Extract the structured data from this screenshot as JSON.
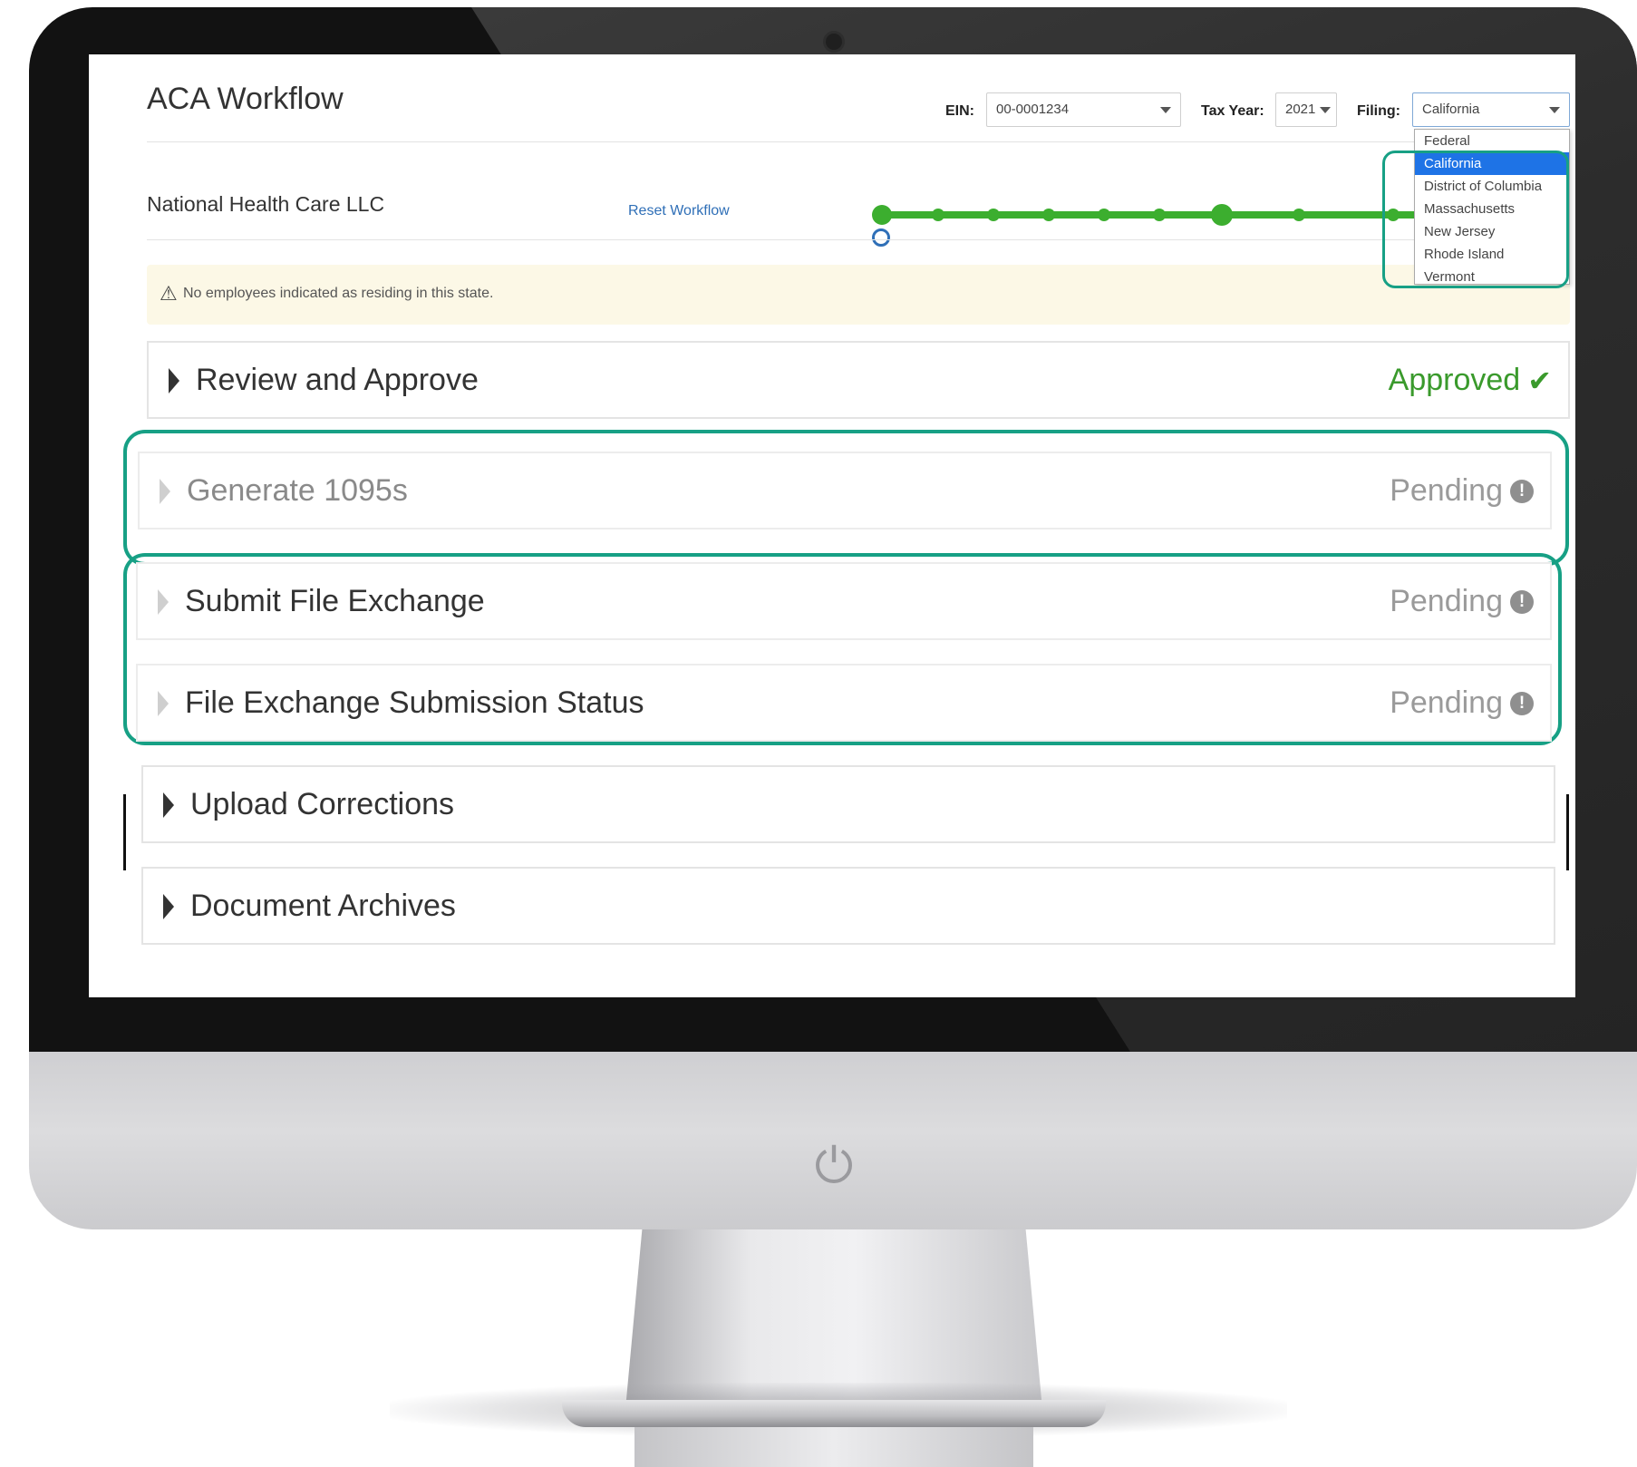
{
  "app": {
    "title": "ACA Workflow"
  },
  "filters": {
    "ein_label": "EIN:",
    "ein_value": "00-0001234",
    "tax_year_label": "Tax Year:",
    "tax_year_value": "2021",
    "filing_label": "Filing:",
    "filing_value": "California",
    "filing_options": [
      "Federal",
      "California",
      "District of Columbia",
      "Massachusetts",
      "New Jersey",
      "Rhode Island",
      "Vermont"
    ]
  },
  "company": {
    "name": "National Health Care LLC",
    "reset_label": "Reset Workflow"
  },
  "alert": {
    "text": "No employees indicated as residing in this state."
  },
  "steps": [
    {
      "label": "Review and Approve",
      "status": "Approved"
    },
    {
      "label": "Generate 1095s",
      "status": "Pending"
    },
    {
      "label": "Submit File Exchange",
      "status": "Pending"
    },
    {
      "label": "File Exchange Submission Status",
      "status": "Pending"
    },
    {
      "label": "Upload Corrections",
      "status": ""
    },
    {
      "label": "Document Archives",
      "status": ""
    }
  ],
  "colors": {
    "accent_green": "#3cae2f",
    "highlight_teal": "#17a085",
    "link_blue": "#2f6fb7",
    "selection_blue": "#1e73e6",
    "alert_bg": "#fcf8e6"
  },
  "icons": {
    "power": "power-icon",
    "alert": "warning-triangle-icon",
    "approved": "check-icon",
    "pending": "exclamation-circle-icon",
    "row_toggle": "caret-right-icon"
  }
}
